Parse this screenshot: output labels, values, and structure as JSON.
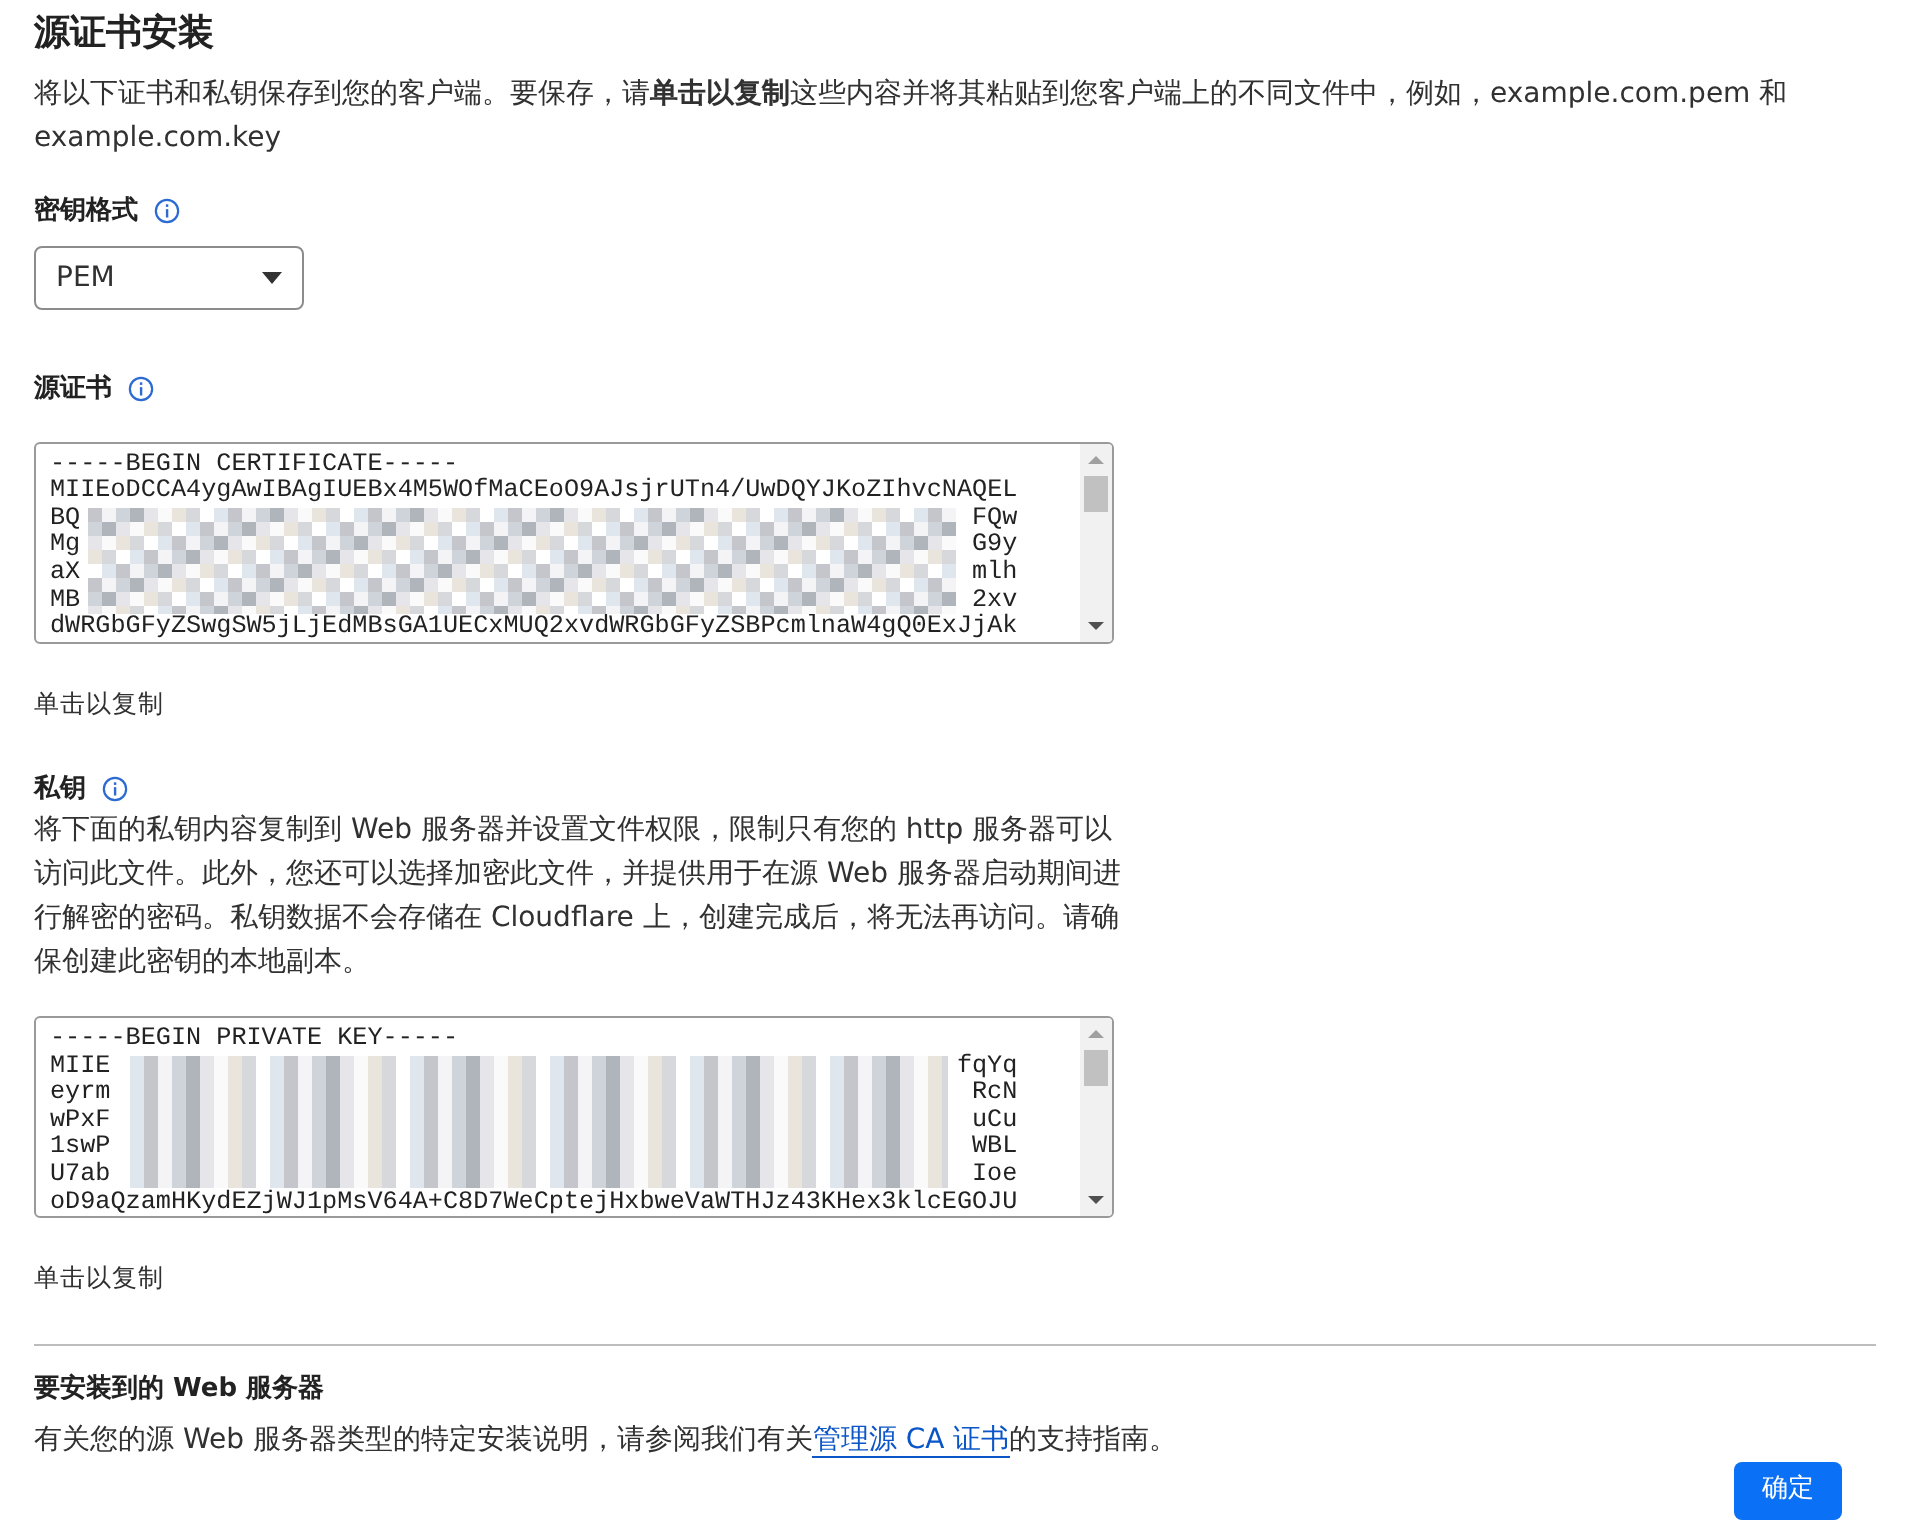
{
  "title": "源证书安装",
  "intro": "将以下证书和私钥保存到您的客户端。要保存，请**单击以复制**这些内容并将其粘贴到您客户端上的不同文件中，例如，example.com.pem 和 example.com.key",
  "key_format": {
    "label": "密钥格式",
    "select": {
      "value": "PEM"
    }
  },
  "certificate": {
    "label": "源证书",
    "lines": [
      {
        "kind": "plain",
        "text": "-----BEGIN CERTIFICATE-----"
      },
      {
        "kind": "plain",
        "text": "MIIEoDCCA4ygAwIBAgIUEBx4M5WOfMaCEoO9AJsjrUTn4/UwDQYJKoZIhvcNAQEL"
      },
      {
        "kind": "redacted",
        "start": "BQ",
        "end": "FQw"
      },
      {
        "kind": "redacted",
        "start": "Mg",
        "end": "G9y"
      },
      {
        "kind": "redacted",
        "start": "aX",
        "end": "mlh"
      },
      {
        "kind": "redacted",
        "start": "MB",
        "end": "2xv"
      },
      {
        "kind": "plain",
        "text": "dWRGbGFyZSwgSW5jLjEdMBsGA1UECxMUQ2xvdWRGbGFyZSBPcmlnaW4gQ0ExJjAk"
      }
    ],
    "copy_link": "单击以复制"
  },
  "private_key": {
    "label": "私钥",
    "description": "将下面的私钥内容复制到 Web 服务器并设置文件权限，限制只有您的 http 服务器可以访问此文件。此外，您还可以选择加密此文件，并提供用于在源 Web 服务器启动期间进行解密的密码。私钥数据不会存储在 Cloudflare 上，创建完成后，将无法再访问。请确保创建此密钥的本地副本。",
    "lines": [
      {
        "kind": "plain",
        "text": "-----BEGIN PRIVATE KEY-----"
      },
      {
        "kind": "redacted",
        "start": "MIIE",
        "end": "fqYq"
      },
      {
        "kind": "redacted",
        "start": "eyrm",
        "end": "RcN"
      },
      {
        "kind": "redacted",
        "start": "wPxF",
        "end": "uCu"
      },
      {
        "kind": "redacted",
        "start": "1swP",
        "end": "WBL"
      },
      {
        "kind": "redacted",
        "start": "U7ab",
        "end": "Ioe"
      },
      {
        "kind": "plain",
        "text": "oD9aQzamHKydEZjWJ1pMsV64A+C8D7WeCptejHxbweVaWTHJz43KHex3klcEGOJU"
      }
    ],
    "copy_link": "单击以复制"
  },
  "servers": {
    "heading": "要安装到的 Web 服务器",
    "text_before": "有关您的源 Web 服务器类型的特定安装说明，请参阅我们有关",
    "link": "管理源 CA 证书",
    "text_after": "的支持指南。"
  },
  "confirm_button": "确定"
}
